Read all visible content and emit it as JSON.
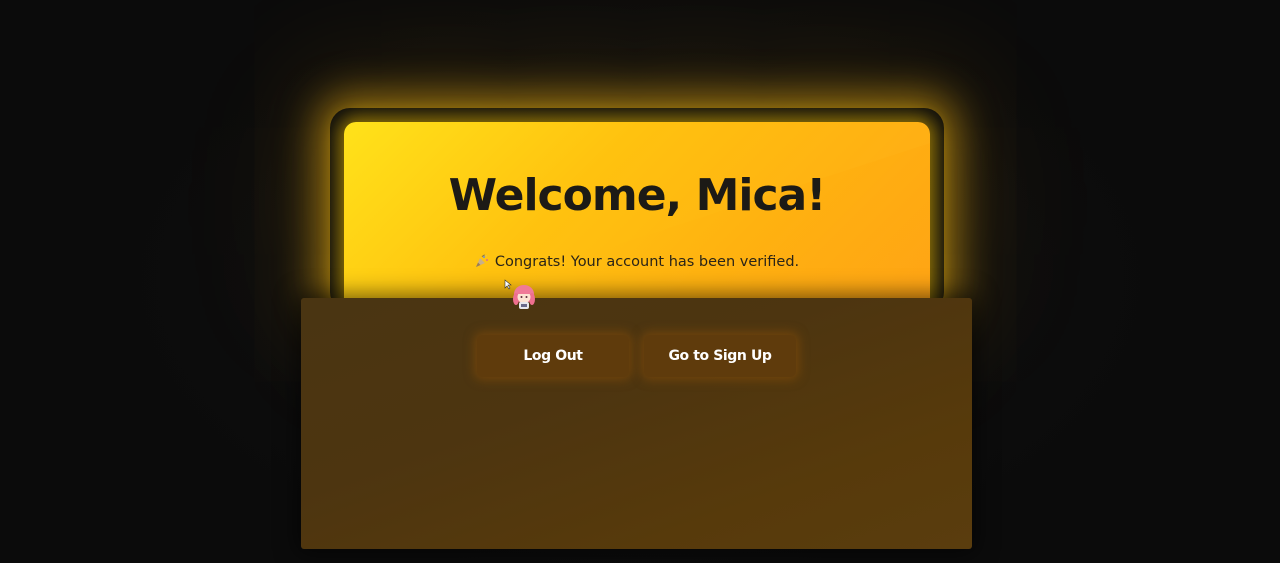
{
  "welcome": {
    "title": "Welcome, Mica!",
    "message": "Congrats! Your account has been verified.",
    "message_icon": "party-popper-icon"
  },
  "actions": {
    "logout_label": "Log Out",
    "signup_label": "Go to Sign Up"
  },
  "cursor": {
    "icon": "anime-girl-cursor-icon"
  },
  "colors": {
    "background": "#0b0b0b",
    "card_gradient_start": "#ffe21a",
    "card_gradient_end": "#ffa51c",
    "panel": "#4d3510",
    "button": "#5f3b0c",
    "title_text": "#1c1a16"
  }
}
